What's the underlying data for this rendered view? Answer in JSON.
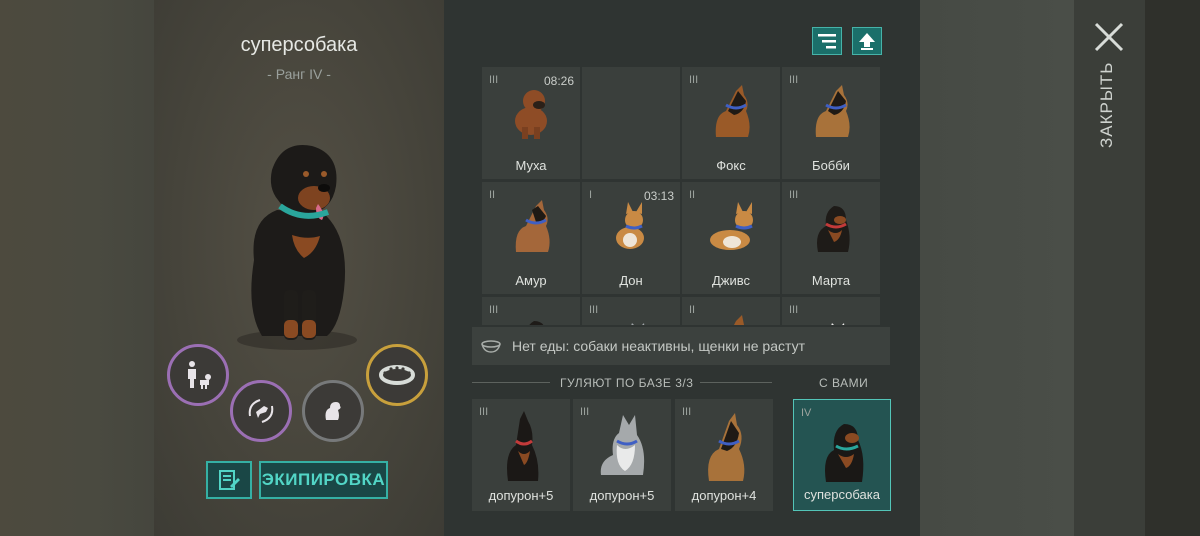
{
  "hero": {
    "name": "суперсобака",
    "rank": "- Ранг IV -"
  },
  "actions": {
    "equipment_label": "ЭКИПИРОВКА",
    "icons": [
      "owner-dog-icon",
      "fetch-training-icon",
      "puppy-icon",
      "spiked-collar-icon",
      "notes-icon"
    ]
  },
  "toolbar": {
    "icons": [
      "sort-filter-icon",
      "upload-arrow-icon"
    ]
  },
  "kennel": [
    {
      "rank": "III",
      "timer": "08:26",
      "name": "Муха",
      "breed": "boxer"
    },
    {
      "rank": "",
      "timer": "",
      "name": "",
      "breed": "empty"
    },
    {
      "rank": "III",
      "timer": "",
      "name": "Фокс",
      "breed": "shepherd"
    },
    {
      "rank": "III",
      "timer": "",
      "name": "Бобби",
      "breed": "shepherd"
    },
    {
      "rank": "II",
      "timer": "",
      "name": "Амур",
      "breed": "shepherd"
    },
    {
      "rank": "I",
      "timer": "03:13",
      "name": "Дон",
      "breed": "corgi"
    },
    {
      "rank": "II",
      "timer": "",
      "name": "Дживс",
      "breed": "corgi"
    },
    {
      "rank": "III",
      "timer": "",
      "name": "Марта",
      "breed": "rottweiler"
    },
    {
      "rank": "III",
      "timer": "",
      "name": "",
      "breed": "rottweiler"
    },
    {
      "rank": "III",
      "timer": "",
      "name": "",
      "breed": "husky"
    },
    {
      "rank": "II",
      "timer": "",
      "name": "",
      "breed": "shepherd"
    },
    {
      "rank": "III",
      "timer": "",
      "name": "",
      "breed": "white"
    }
  ],
  "info": {
    "icon": "food-bowl-icon",
    "text": "Нет еды: собаки неактивны, щенки не растут"
  },
  "base": {
    "label": "ГУЛЯЮТ ПО БАЗЕ 3/3",
    "dogs": [
      {
        "rank": "III",
        "name": "допурон+5",
        "breed": "doberman"
      },
      {
        "rank": "III",
        "name": "допурон+5",
        "breed": "husky"
      },
      {
        "rank": "III",
        "name": "допурон+4",
        "breed": "shepherd"
      }
    ]
  },
  "with_you": {
    "label": "С ВАМИ",
    "dog": {
      "rank": "IV",
      "name": "суперсобака",
      "breed": "rottweiler"
    }
  },
  "close": {
    "label": "ЗАКРЫТЬ"
  },
  "colors": {
    "accent": "#35b0a4",
    "purple_ring": "#9b6fb4",
    "gold_ring": "#c8a03c"
  }
}
